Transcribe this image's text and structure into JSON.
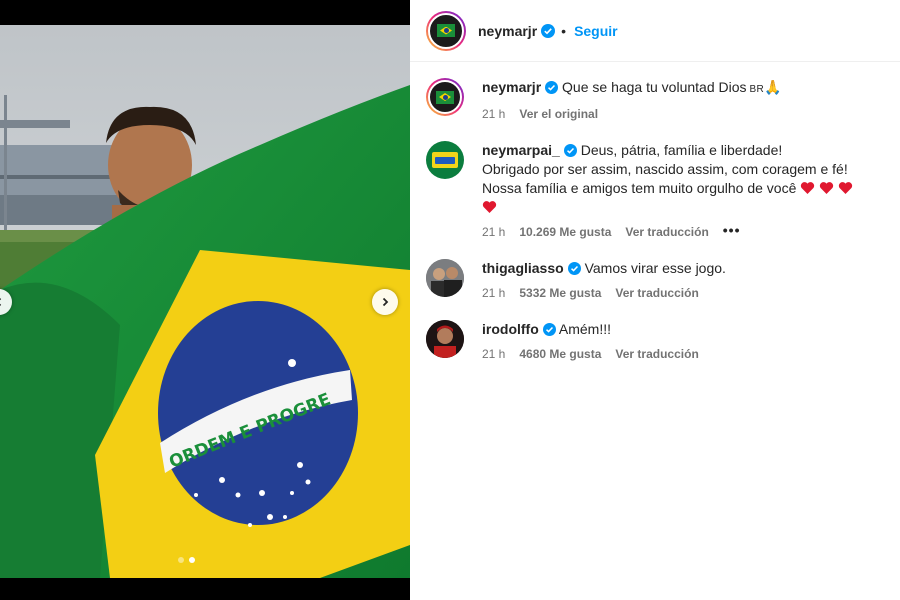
{
  "post": {
    "username": "neymarjr",
    "follow_label": "Seguir",
    "separator": "•",
    "caption": "Que se haga tu voluntad Dios",
    "caption_flag": "BR",
    "caption_emoji": "🙏",
    "time": "21 h",
    "see_original": "Ver el original"
  },
  "carousel": {
    "slide_count": 2,
    "active_slide": 2
  },
  "comments": [
    {
      "username": "neymarpai_",
      "text_line1": "Deus, pátria, família e liberdade!",
      "text_line2": "Obrigado por ser assim, nascido assim, com coragem e fé!",
      "text_line3": "Nossa família e amigos tem muito orgulho de você",
      "time": "21 h",
      "likes": "10.269 Me gusta",
      "translate": "Ver traducción",
      "more": "•••"
    },
    {
      "username": "thigagliasso",
      "text": "Vamos virar esse jogo.",
      "time": "21 h",
      "likes": "5332 Me gusta",
      "translate": "Ver traducción"
    },
    {
      "username": "irodolffo",
      "text": "Amém!!!",
      "time": "21 h",
      "likes": "4680 Me gusta",
      "translate": "Ver traducción"
    }
  ],
  "colors": {
    "link_blue": "#0095f6",
    "verified_blue": "#0095f6",
    "heart_red": "#ed4956",
    "muted_text": "#737373"
  },
  "icons": [
    "verified-badge-icon",
    "chevron-right-icon",
    "chevron-left-icon",
    "heart-icon",
    "more-options-icon"
  ]
}
